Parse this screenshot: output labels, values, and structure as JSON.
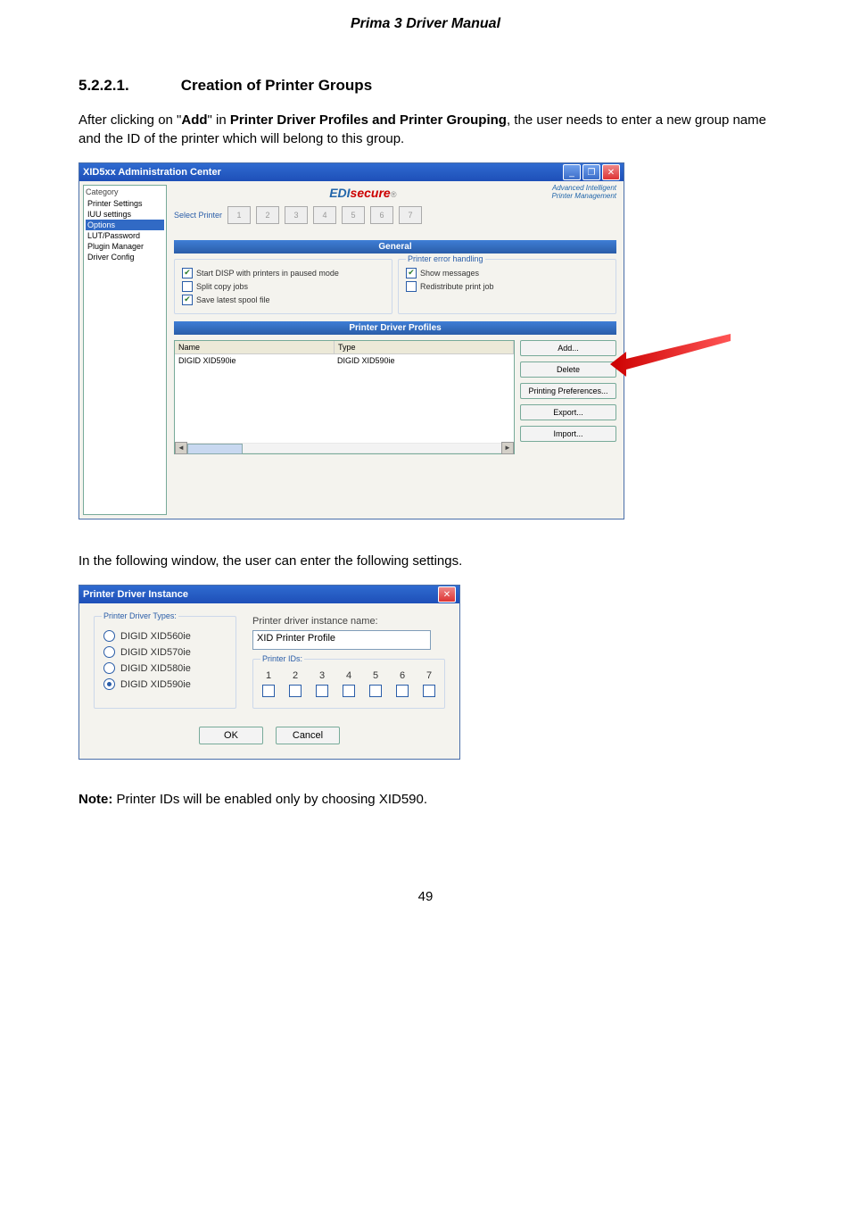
{
  "doc": {
    "title": "Prima 3 Driver Manual",
    "sec_num": "5.2.2.1.",
    "sec_title": "Creation of Printer Groups",
    "para1_a": "After clicking on \"",
    "para1_add": "Add",
    "para1_b": "\" in ",
    "para1_bold": "Printer Driver Profiles and Printer Grouping",
    "para1_c": ", the user needs to enter a new group name and the ID of the printer which will belong to this group.",
    "para2": "In the following window, the user can enter the following settings.",
    "para3_bold": "Note:",
    "para3_rest": " Printer IDs will be enabled only by choosing XID590.",
    "page_num": "49"
  },
  "win1": {
    "title": "XID5xx Administration Center",
    "min": "_",
    "max": "❐",
    "close": "✕",
    "cat_header": "Category",
    "categories": [
      "Printer Settings",
      "IUU settings",
      "Options",
      "LUT/Password",
      "Plugin Manager",
      "Driver Config"
    ],
    "brand_e": "EDI",
    "brand_s": "secure",
    "brand_star": "®",
    "tagline1": "Advanced Intelligent",
    "tagline2": "Printer Management",
    "select_printer": "Select Printer",
    "printer_nums": [
      "1",
      "2",
      "3",
      "4",
      "5",
      "6",
      "7"
    ],
    "band_general": "General",
    "chk_start": "Start DISP with printers in paused mode",
    "chk_split": "Split copy jobs",
    "chk_save": "Save latest spool file",
    "err_group": "Printer error handling",
    "chk_show": "Show messages",
    "chk_redist": "Redistribute print job",
    "band_profiles": "Printer Driver Profiles",
    "col_name": "Name",
    "col_type": "Type",
    "row_name": "DIGID XID590ie",
    "row_type": "DIGID XID590ie",
    "btns": {
      "add": "Add...",
      "del": "Delete",
      "pref": "Printing Preferences...",
      "exp": "Export...",
      "imp": "Import..."
    },
    "ar_l": "◄",
    "ar_r": "►"
  },
  "win2": {
    "title": "Printer Driver Instance",
    "close": "✕",
    "types_label": "Printer Driver Types:",
    "opts": [
      "DIGID XID560ie",
      "DIGID XID570ie",
      "DIGID XID580ie",
      "DIGID XID590ie"
    ],
    "inst_label": "Printer driver instance name:",
    "inst_value": "XID Printer Profile",
    "ids_label": "Printer IDs:",
    "ids": [
      "1",
      "2",
      "3",
      "4",
      "5",
      "6",
      "7"
    ],
    "ok": "OK",
    "cancel": "Cancel"
  }
}
